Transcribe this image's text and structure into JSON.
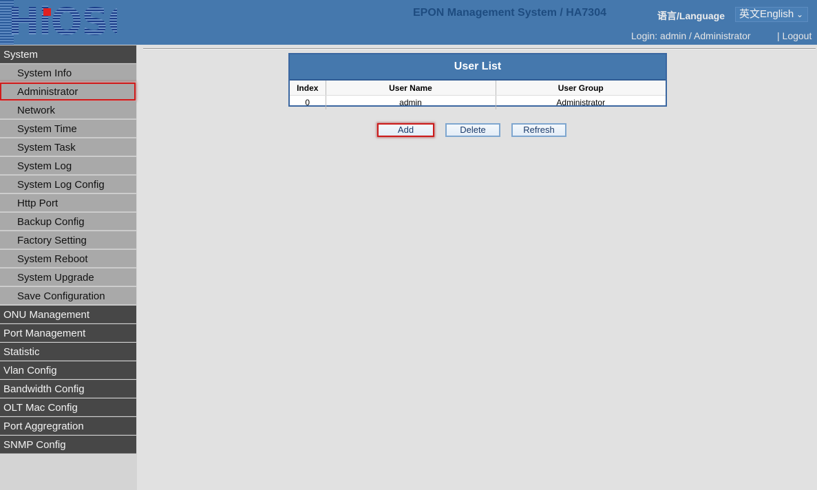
{
  "header": {
    "logo_text": "HiOSO",
    "system_title": "EPON Management System / HA7304",
    "language_label": "语言/Language",
    "language_selected": "英文English",
    "login_info": "Login: admin / Administrator",
    "logout_label": "| Logout"
  },
  "sidebar": {
    "system": "System",
    "children": [
      "System Info",
      "Administrator",
      "Network",
      "System Time",
      "System Task",
      "System Log",
      "System Log Config",
      "Http Port",
      "Backup Config",
      "Factory Setting",
      "System Reboot",
      "System Upgrade",
      "Save Configuration"
    ],
    "sections": [
      "ONU Management",
      "Port Management",
      "Statistic",
      "Vlan Config",
      "Bandwidth Config",
      "OLT Mac Config",
      "Port Aggregration",
      "SNMP Config"
    ],
    "selected": "Administrator"
  },
  "user_list": {
    "title": "User List",
    "columns": [
      "Index",
      "User Name",
      "User Group"
    ],
    "rows": [
      [
        "0",
        "admin",
        "Administrator"
      ]
    ]
  },
  "actions": {
    "add": "Add",
    "delete": "Delete",
    "refresh": "Refresh"
  }
}
